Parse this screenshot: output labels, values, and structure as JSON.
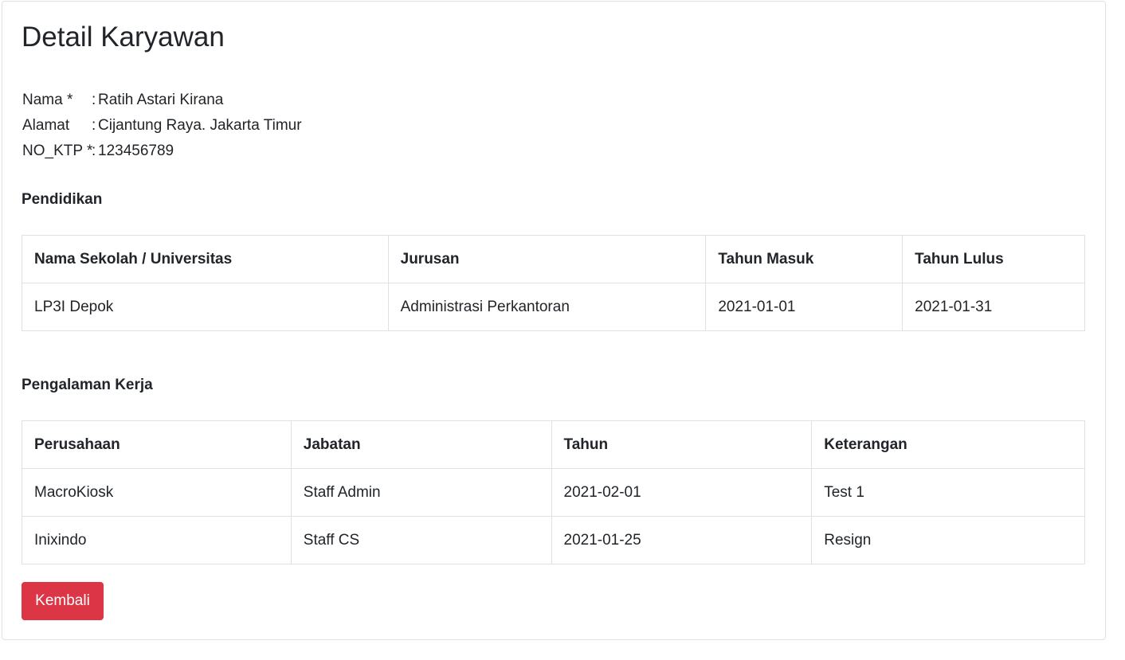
{
  "page": {
    "title": "Detail Karyawan"
  },
  "employee": {
    "fields": [
      {
        "label": "Nama *",
        "sep": ":",
        "value": "Ratih Astari Kirana"
      },
      {
        "label": "Alamat",
        "sep": ":",
        "value": "Cijantung Raya. Jakarta Timur"
      },
      {
        "label": "NO_KTP *",
        "sep": ":",
        "value": "123456789"
      }
    ]
  },
  "education": {
    "title": "Pendidikan",
    "headers": [
      "Nama Sekolah / Universitas",
      "Jurusan",
      "Tahun Masuk",
      "Tahun Lulus"
    ],
    "rows": [
      [
        "LP3I Depok",
        "Administrasi Perkantoran",
        "2021-01-01",
        "2021-01-31"
      ]
    ]
  },
  "experience": {
    "title": "Pengalaman Kerja",
    "headers": [
      "Perusahaan",
      "Jabatan",
      "Tahun",
      "Keterangan"
    ],
    "rows": [
      [
        "MacroKiosk",
        "Staff Admin",
        "2021-02-01",
        "Test 1"
      ],
      [
        "Inixindo",
        "Staff CS",
        "2021-01-25",
        "Resign"
      ]
    ]
  },
  "actions": {
    "back_label": "Kembali",
    "back_color": "#dc3545"
  }
}
